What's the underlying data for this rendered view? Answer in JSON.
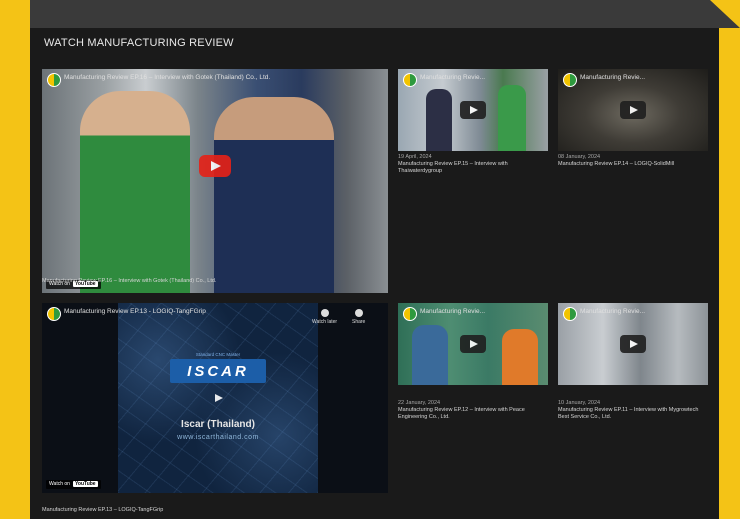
{
  "section": {
    "title": "WATCH MANUFACTURING REVIEW"
  },
  "main_video_1": {
    "overlay_title": "Manufacturing Review EP.16 – Interview with Gotek (Thailand) Co., Ltd.",
    "watch_label": "Watch on",
    "yt_label": "YouTube",
    "caption": "Manufacturing Review EP.16 – Interview with Gotek (Thailand) Co., Ltd."
  },
  "main_video_2": {
    "overlay_title": "Manufacturing Review EP.13 - LOGIQ-TangFGrip",
    "watch_later": "Watch later",
    "share": "Share",
    "logo_top": "Standard CNC Master",
    "logo_text": "ISCAR",
    "company": "Iscar (Thailand)",
    "website": "www.iscarthailand.com",
    "watch_label": "Watch on",
    "yt_label": "YouTube",
    "caption": "Manufacturing Review EP.13 – LOGIQ-TangFGrip"
  },
  "thumbs": [
    {
      "overlay_title": "Manufacturing Revie...",
      "date": "19 April, 2024",
      "title": "Manufacturing Review EP.15 – Interview with Thaiwaterdygroup"
    },
    {
      "overlay_title": "Manufacturing Revie...",
      "date": "08 January, 2024",
      "title": "Manufacturing Review EP.14 – LOGIQ-SolidMill"
    },
    {
      "overlay_title": "Manufacturing Revie...",
      "date": "22 January, 2024",
      "title": "Manufacturing Review EP.12 – Interview with Peace Engineering Co., Ltd."
    },
    {
      "overlay_title": "Manufacturing Revie...",
      "date": "10 January, 2024",
      "title": "Manufacturing Review EP.11 – Interview with Mygrowtech Best Service Co., Ltd."
    }
  ]
}
